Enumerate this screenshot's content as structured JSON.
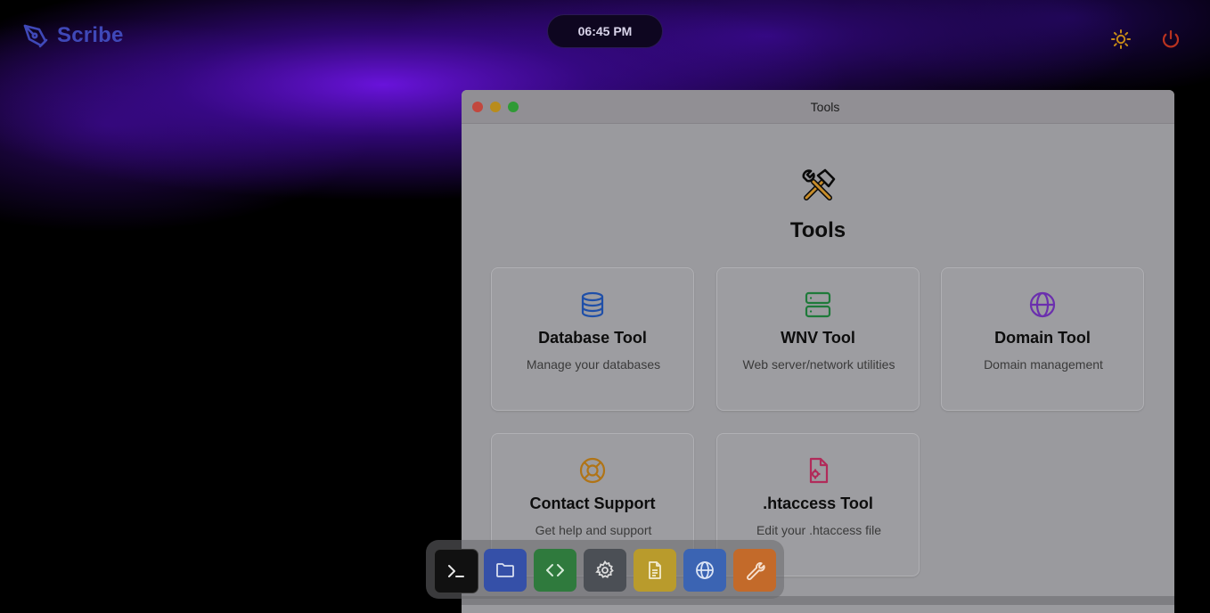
{
  "brand": {
    "name": "Scribe",
    "color": "#3f48b8"
  },
  "clock": {
    "time": "06:45 PM"
  },
  "topbar": {
    "icons": [
      "sun-icon",
      "power-icon"
    ]
  },
  "window": {
    "title": "Tools",
    "heading": "Tools",
    "cards": [
      {
        "title": "Database Tool",
        "description": "Manage your databases",
        "icon": "database-icon",
        "color": "#1f4fa8"
      },
      {
        "title": "WNV Tool",
        "description": "Web server/network utilities",
        "icon": "server-icon",
        "color": "#1f7a3a"
      },
      {
        "title": "Domain Tool",
        "description": "Domain management",
        "icon": "globe-icon",
        "color": "#6b2fae"
      },
      {
        "title": "Contact Support",
        "description": "Get help and support",
        "icon": "lifebuoy-icon",
        "color": "#b07416"
      },
      {
        "title": ".htaccess Tool",
        "description": "Edit your .htaccess file",
        "icon": "file-gear-icon",
        "color": "#b12b5a"
      }
    ]
  },
  "dock": {
    "items": [
      {
        "name": "terminal",
        "icon": "terminal-icon",
        "color": "#111111"
      },
      {
        "name": "files",
        "icon": "folder-icon",
        "color": "#3550a8"
      },
      {
        "name": "code",
        "icon": "code-icon",
        "color": "#2f7a3d"
      },
      {
        "name": "settings",
        "icon": "gear-icon",
        "color": "#4b4f55"
      },
      {
        "name": "documents",
        "icon": "document-icon",
        "color": "#b99b2c"
      },
      {
        "name": "browser",
        "icon": "globe-icon",
        "color": "#3b64b3"
      },
      {
        "name": "tools",
        "icon": "wrench-icon",
        "color": "#c36a2a"
      }
    ]
  }
}
